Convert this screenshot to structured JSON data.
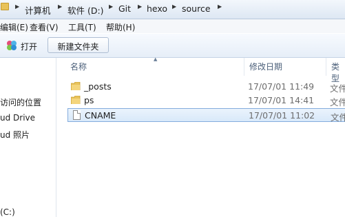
{
  "address_bar": {
    "crumbs": [
      "计算机",
      "软件 (D:)",
      "Git",
      "hexo",
      "source"
    ]
  },
  "menu": {
    "items": [
      "编辑(E)",
      "查看(V)",
      "工具(T)",
      "帮助(H)"
    ]
  },
  "toolbar": {
    "open_label": "打开",
    "new_folder_label": "新建文件夹"
  },
  "nav_pane": {
    "items": [
      "",
      "访问的位置",
      "ud Drive",
      "ud 照片",
      "",
      "(C:)"
    ]
  },
  "file_list": {
    "columns": {
      "name": "名称",
      "date": "修改日期",
      "type": "类型"
    },
    "rows": [
      {
        "name": "_posts",
        "date": "17/07/01 11:49",
        "type": "文件",
        "kind": "folder",
        "selected": false
      },
      {
        "name": "ps",
        "date": "17/07/01 14:41",
        "type": "文件",
        "kind": "folder",
        "selected": false
      },
      {
        "name": "CNAME",
        "date": "17/07/01 11:02",
        "type": "文件",
        "kind": "file",
        "selected": true
      }
    ]
  },
  "colors": {
    "selection_border": "#84acdd",
    "folder": "#e8c25a"
  }
}
